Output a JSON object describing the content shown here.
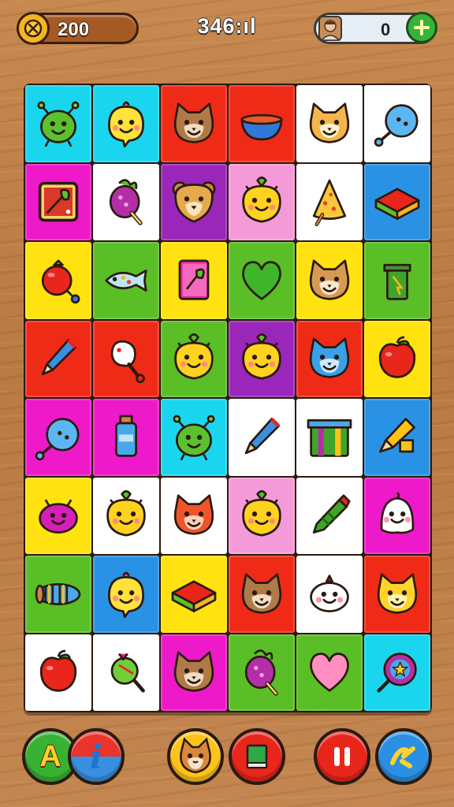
{
  "hud": {
    "coins": "200",
    "timer": "346:ıl",
    "lives": "0",
    "coin_icon": "coin-icon",
    "add_icon": "plus-icon"
  },
  "controls": {
    "hint_letter": "A",
    "info_letter": "i",
    "buttons": [
      "hint-button",
      "info-button",
      "character-button",
      "book-button",
      "pause-button",
      "shuffle-button"
    ]
  },
  "board": {
    "rows": 8,
    "columns": 6,
    "tiles": [
      [
        {
          "bg": "#19d6ee",
          "icon": "green-bug"
        },
        {
          "bg": "#19d6ee",
          "icon": "yellow-chick"
        },
        {
          "bg": "#ef2b17",
          "icon": "brown-cat"
        },
        {
          "bg": "#ef2b17",
          "icon": "bowl"
        },
        {
          "bg": "#ffffff",
          "icon": "orange-cat"
        },
        {
          "bg": "#ffffff",
          "icon": "blue-balloon"
        }
      ],
      [
        {
          "bg": "#ee19c9",
          "icon": "art-frame"
        },
        {
          "bg": "#ffffff",
          "icon": "purple-radish"
        },
        {
          "bg": "#9a26ba",
          "icon": "bear-face"
        },
        {
          "bg": "#f59ad8",
          "icon": "yellow-face"
        },
        {
          "bg": "#ffffff",
          "icon": "cheese-wedge"
        },
        {
          "bg": "#2a92e4",
          "icon": "color-block"
        }
      ],
      [
        {
          "bg": "#ffe20f",
          "icon": "tomato"
        },
        {
          "bg": "#5abe26",
          "icon": "fish"
        },
        {
          "bg": "#ffe20f",
          "icon": "pink-book"
        },
        {
          "bg": "#5abe26",
          "icon": "green-heart"
        },
        {
          "bg": "#ffe20f",
          "icon": "tan-cat"
        },
        {
          "bg": "#5abe26",
          "icon": "trash-can"
        }
      ],
      [
        {
          "bg": "#ef2b17",
          "icon": "blue-pencil"
        },
        {
          "bg": "#ef2b17",
          "icon": "white-drumstick"
        },
        {
          "bg": "#5abe26",
          "icon": "yellow-face"
        },
        {
          "bg": "#9a26ba",
          "icon": "yellow-face"
        },
        {
          "bg": "#ef2b17",
          "icon": "blue-cat"
        },
        {
          "bg": "#ffe20f",
          "icon": "red-apple"
        }
      ],
      [
        {
          "bg": "#ee19c9",
          "icon": "blue-balloon"
        },
        {
          "bg": "#ee19c9",
          "icon": "blue-bottle"
        },
        {
          "bg": "#19d6ee",
          "icon": "green-bug"
        },
        {
          "bg": "#ffffff",
          "icon": "blue-pencil"
        },
        {
          "bg": "#ffffff",
          "icon": "gift-box"
        },
        {
          "bg": "#2a92e4",
          "icon": "yellow-pencil"
        }
      ],
      [
        {
          "bg": "#ffe20f",
          "icon": "purple-blob"
        },
        {
          "bg": "#ffffff",
          "icon": "yellow-face"
        },
        {
          "bg": "#ffffff",
          "icon": "red-cat"
        },
        {
          "bg": "#f59ad8",
          "icon": "yellow-face"
        },
        {
          "bg": "#ffffff",
          "icon": "green-crayon"
        },
        {
          "bg": "#ee19c9",
          "icon": "white-ghost"
        }
      ],
      [
        {
          "bg": "#5abe26",
          "icon": "striped-roll"
        },
        {
          "bg": "#2a92e4",
          "icon": "yellow-chick"
        },
        {
          "bg": "#ffe20f",
          "icon": "color-block"
        },
        {
          "bg": "#ef2b17",
          "icon": "brown-cat"
        },
        {
          "bg": "#ffffff",
          "icon": "white-seal"
        },
        {
          "bg": "#ef2b17",
          "icon": "yellow-cat"
        }
      ],
      [
        {
          "bg": "#ffffff",
          "icon": "red-apple"
        },
        {
          "bg": "#ffffff",
          "icon": "green-lollipop"
        },
        {
          "bg": "#ee19c9",
          "icon": "brown-cat"
        },
        {
          "bg": "#5abe26",
          "icon": "purple-radish"
        },
        {
          "bg": "#5abe26",
          "icon": "pink-heart"
        },
        {
          "bg": "#19d6ee",
          "icon": "star-lollipop"
        }
      ]
    ]
  }
}
